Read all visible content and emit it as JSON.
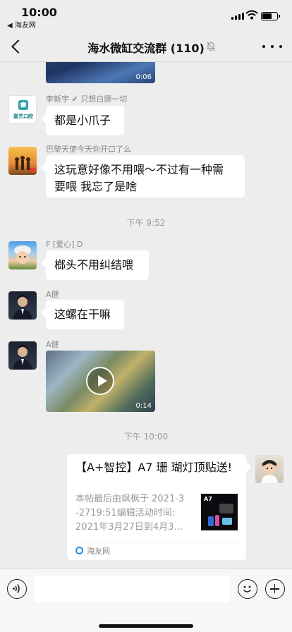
{
  "status_bar": {
    "time": "10:00",
    "back_app": "◀ 海友网",
    "battery_level": 0.7
  },
  "nav": {
    "title": "海水微缸交流群 (110)",
    "mute_icon": "bell-off-icon",
    "more_icon": "ellipsis-icon"
  },
  "messages": [
    {
      "type": "video",
      "duration": "0:06"
    },
    {
      "type": "text",
      "sender": "李新宇 ✔ 只想白嫖一切",
      "avatar_text": "嘉艺口腔",
      "text": "都是小爪子"
    },
    {
      "type": "text",
      "sender": "巴黎天使今天你开口了么",
      "text_line1": "这玩意好像不用喂～不过有一种需",
      "text_line2": "要喂 我忘了是啥"
    },
    {
      "type": "time",
      "text": "下午 9:52"
    },
    {
      "type": "text",
      "sender": "F [爱心] D",
      "text": "榔头不用纠结喂"
    },
    {
      "type": "text",
      "sender": "A健",
      "text": "这螺在干嘛"
    },
    {
      "type": "video",
      "sender": "A健",
      "duration": "0:14"
    },
    {
      "type": "time",
      "text": "下午 10:00"
    },
    {
      "type": "link",
      "title": "【A+智控】A7 珊 瑚灯顶贴送!",
      "desc_line1": "本帖最后由飒枫于 2021-3",
      "desc_line2": "-2719:51编辑活动时间:",
      "desc_line3": "2021年3月27日到4月3...",
      "thumb_label": "A7",
      "source": "海友网"
    }
  ],
  "input": {
    "voice_icon": "voice-icon",
    "emoji_icon": "emoji-icon",
    "add_icon": "plus-circle-icon"
  },
  "colors": {
    "background": "#ededed",
    "bubble": "#ffffff",
    "link_source": "#2b8bd8"
  }
}
